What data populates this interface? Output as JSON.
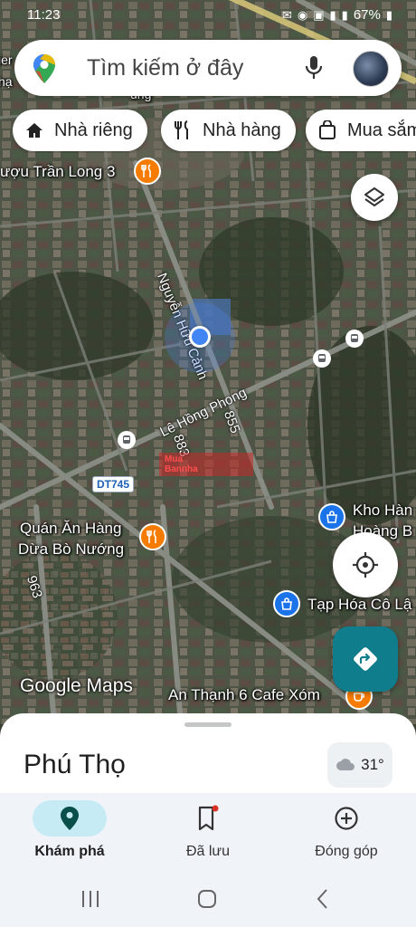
{
  "status_bar": {
    "time": "11:23",
    "battery": "67%"
  },
  "search": {
    "placeholder": "Tìm kiếm ở đây"
  },
  "chips": [
    {
      "label": "Nhà riêng",
      "icon": "home-icon"
    },
    {
      "label": "Nhà hàng",
      "icon": "restaurant-icon"
    },
    {
      "label": "Mua sắm",
      "icon": "shopping-bag-icon"
    }
  ],
  "map": {
    "labels": {
      "tran_long": "ượu Trần Long 3",
      "quan_an_1": "Quán Ăn Hàng",
      "quan_an_2": "Dừa Bò Nướng",
      "kho_han_1": "Kho Hàn",
      "kho_han_2": "Hoàng B",
      "tap_hoa": "Tạp Hóa Cô Lậ",
      "an_thanh": "An Thạnh 6 Cafe Xóm",
      "edge_ier": "ier",
      "edge_hal": "hạ",
      "edge_ung": "ung"
    },
    "roads": {
      "nguyen_huu_canh": "Nguyễn Hữu Cảnh",
      "le_hong_phong": "Lê Hồng Phong",
      "r883": "883",
      "r855": "855",
      "r963": "963"
    },
    "route_badge": "DT745",
    "watermark_1": "Mua",
    "watermark_2": "Bannha",
    "attribution": "Google Maps"
  },
  "sheet": {
    "place": "Phú Thọ",
    "temperature": "31°"
  },
  "nav": [
    {
      "label": "Khám phá",
      "icon": "explore-pin-icon",
      "active": true
    },
    {
      "label": "Đã lưu",
      "icon": "bookmark-icon",
      "active": false
    },
    {
      "label": "Đóng góp",
      "icon": "add-circle-icon",
      "active": false
    }
  ],
  "colors": {
    "accent": "#0f7d8c",
    "location_blue": "#4285f4",
    "poi_orange": "#f57c00",
    "poi_blue": "#1a73e8"
  }
}
